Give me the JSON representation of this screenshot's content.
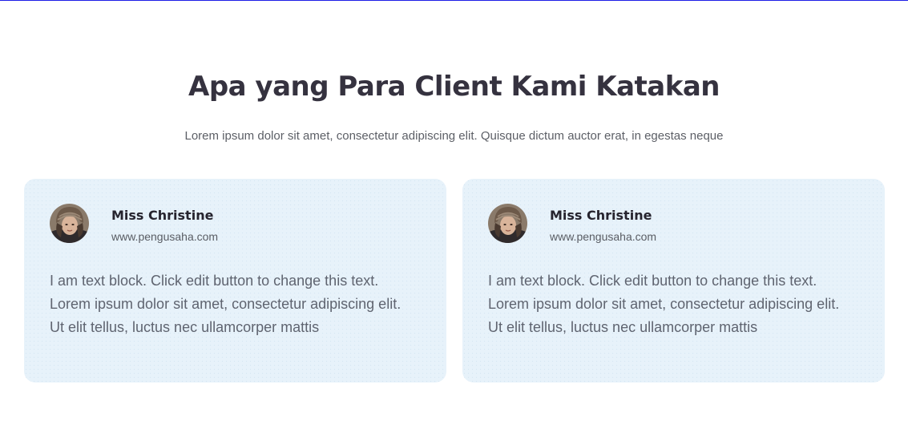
{
  "section": {
    "title": "Apa yang Para Client Kami Katakan",
    "subtitle": "Lorem ipsum dolor sit amet, consectetur adipiscing elit. Quisque dictum auctor erat, in egestas neque"
  },
  "colors": {
    "title": "#35323f",
    "card_background": "#e7f2fa",
    "top_accent_line": "#1e1ee6"
  },
  "testimonials": [
    {
      "avatar_icon": "woman-avatar",
      "name": "Miss Christine",
      "website": "www.pengusaha.com",
      "quote_lines": [
        "I am text block. Click edit button to change this text.",
        "Lorem ipsum dolor sit amet, consectetur adipiscing elit.",
        "Ut elit tellus, luctus nec ullamcorper mattis"
      ]
    },
    {
      "avatar_icon": "woman-avatar",
      "name": "Miss Christine",
      "website": "www.pengusaha.com",
      "quote_lines": [
        "I am text block. Click edit button to change this text.",
        "Lorem ipsum dolor sit amet, consectetur adipiscing elit.",
        "Ut elit tellus, luctus nec ullamcorper mattis"
      ]
    }
  ]
}
